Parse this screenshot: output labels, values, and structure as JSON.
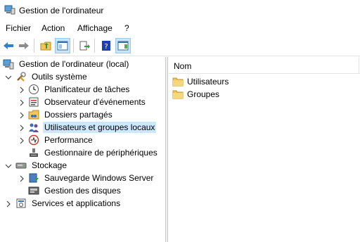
{
  "window": {
    "title": "Gestion de l'ordinateur"
  },
  "menu": [
    "Fichier",
    "Action",
    "Affichage",
    "?"
  ],
  "toolbar": {
    "buttons": [
      "back-icon",
      "forward-icon",
      "folder-up-icon",
      "show-hide-tree-icon",
      "export-list-icon",
      "help-icon",
      "show-hide-action-pane-icon"
    ]
  },
  "tree": {
    "root": "Gestion de l'ordinateur (local)",
    "items": [
      "Outils système",
      "Planificateur de tâches",
      "Observateur d'événements",
      "Dossiers partagés",
      "Utilisateurs et groupes locaux",
      "Performance",
      "Gestionnaire de périphériques",
      "Stockage",
      "Sauvegarde Windows Server",
      "Gestion des disques",
      "Services et applications"
    ],
    "selected": "Utilisateurs et groupes locaux"
  },
  "list": {
    "column": "Nom",
    "items": [
      "Utilisateurs",
      "Groupes"
    ]
  },
  "colors": {
    "selection": "#cce8ff",
    "accent": "#1e6fc5"
  }
}
